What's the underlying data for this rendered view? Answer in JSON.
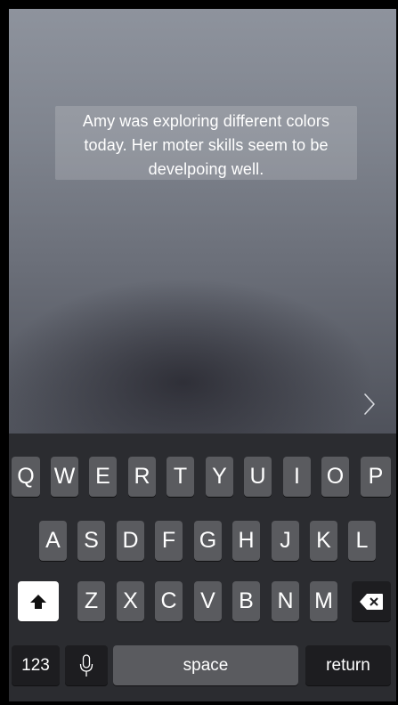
{
  "note": {
    "text": "Amy was exploring different colors today. Her moter skills seem to be develpoing well."
  },
  "next_icon": "chevron-right",
  "keyboard": {
    "row1": [
      "Q",
      "W",
      "E",
      "R",
      "T",
      "Y",
      "U",
      "I",
      "O",
      "P"
    ],
    "row2": [
      "A",
      "S",
      "D",
      "F",
      "G",
      "H",
      "J",
      "K",
      "L"
    ],
    "row3": [
      "Z",
      "X",
      "C",
      "V",
      "B",
      "N",
      "M"
    ],
    "numbers_label": "123",
    "space_label": "space",
    "return_label": "return",
    "shift_icon": "shift-arrow-up",
    "delete_icon": "backspace",
    "mic_icon": "microphone"
  }
}
